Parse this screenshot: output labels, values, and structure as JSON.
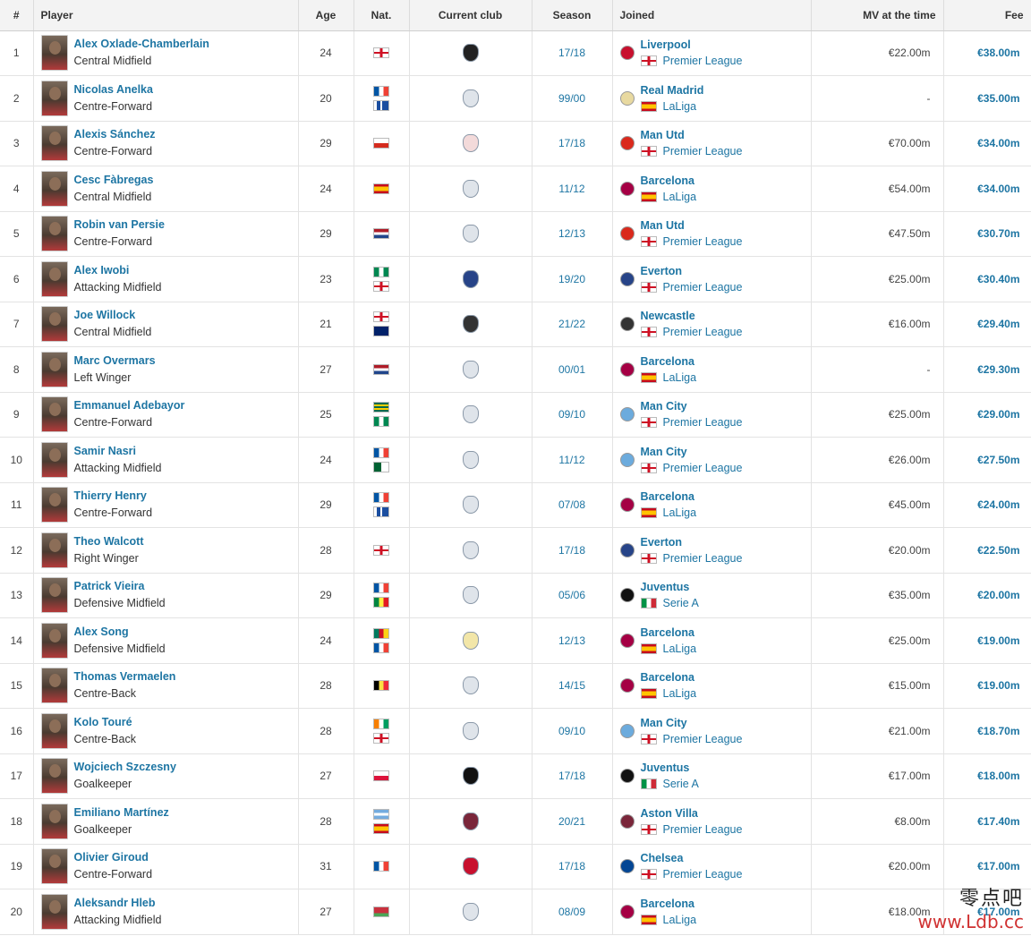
{
  "headers": {
    "num": "#",
    "player": "Player",
    "age": "Age",
    "nat": "Nat.",
    "club": "Current club",
    "season": "Season",
    "joined": "Joined",
    "mv": "MV at the time",
    "fee": "Fee"
  },
  "rows": [
    {
      "num": "1",
      "name": "Alex Oxlade-Chamberlain",
      "position": "Central Midfield",
      "age": "24",
      "nat": [
        "england"
      ],
      "club_icon": "besiktas-crest-icon",
      "season": "17/18",
      "joined_club": "Liverpool",
      "league": "Premier League",
      "league_flag": "england",
      "joined_icon": "liverpool-crest-icon",
      "mv": "€22.00m",
      "fee": "€38.00m"
    },
    {
      "num": "2",
      "name": "Nicolas Anelka",
      "position": "Centre-Forward",
      "age": "20",
      "nat": [
        "france",
        "guadeloupe"
      ],
      "club_icon": "retired-icon",
      "season": "99/00",
      "joined_club": "Real Madrid",
      "league": "LaLiga",
      "league_flag": "spain",
      "joined_icon": "real-madrid-crest-icon",
      "mv": "-",
      "fee": "€35.00m"
    },
    {
      "num": "3",
      "name": "Alexis Sánchez",
      "position": "Centre-Forward",
      "age": "29",
      "nat": [
        "chile"
      ],
      "club_icon": "without-club-icon",
      "season": "17/18",
      "joined_club": "Man Utd",
      "league": "Premier League",
      "league_flag": "england",
      "joined_icon": "man-utd-crest-icon",
      "mv": "€70.00m",
      "fee": "€34.00m"
    },
    {
      "num": "4",
      "name": "Cesc Fàbregas",
      "position": "Central Midfield",
      "age": "24",
      "nat": [
        "spain"
      ],
      "club_icon": "retired-icon",
      "season": "11/12",
      "joined_club": "Barcelona",
      "league": "LaLiga",
      "league_flag": "spain",
      "joined_icon": "barcelona-crest-icon",
      "mv": "€54.00m",
      "fee": "€34.00m"
    },
    {
      "num": "5",
      "name": "Robin van Persie",
      "position": "Centre-Forward",
      "age": "29",
      "nat": [
        "netherlands"
      ],
      "club_icon": "retired-icon",
      "season": "12/13",
      "joined_club": "Man Utd",
      "league": "Premier League",
      "league_flag": "england",
      "joined_icon": "man-utd-crest-icon",
      "mv": "€47.50m",
      "fee": "€30.70m"
    },
    {
      "num": "6",
      "name": "Alex Iwobi",
      "position": "Attacking Midfield",
      "age": "23",
      "nat": [
        "nigeria",
        "england"
      ],
      "club_icon": "everton-crest-icon",
      "season": "19/20",
      "joined_club": "Everton",
      "league": "Premier League",
      "league_flag": "england",
      "joined_icon": "everton-crest-icon",
      "mv": "€25.00m",
      "fee": "€30.40m"
    },
    {
      "num": "7",
      "name": "Joe Willock",
      "position": "Central Midfield",
      "age": "21",
      "nat": [
        "england",
        "montserrat"
      ],
      "club_icon": "newcastle-crest-icon",
      "season": "21/22",
      "joined_club": "Newcastle",
      "league": "Premier League",
      "league_flag": "england",
      "joined_icon": "newcastle-crest-icon",
      "mv": "€16.00m",
      "fee": "€29.40m"
    },
    {
      "num": "8",
      "name": "Marc Overmars",
      "position": "Left Winger",
      "age": "27",
      "nat": [
        "netherlands"
      ],
      "club_icon": "retired-icon",
      "season": "00/01",
      "joined_club": "Barcelona",
      "league": "LaLiga",
      "league_flag": "spain",
      "joined_icon": "barcelona-crest-icon",
      "mv": "-",
      "fee": "€29.30m"
    },
    {
      "num": "9",
      "name": "Emmanuel Adebayor",
      "position": "Centre-Forward",
      "age": "25",
      "nat": [
        "togo",
        "nigeria"
      ],
      "club_icon": "retired-icon",
      "season": "09/10",
      "joined_club": "Man City",
      "league": "Premier League",
      "league_flag": "england",
      "joined_icon": "man-city-crest-icon",
      "mv": "€25.00m",
      "fee": "€29.00m"
    },
    {
      "num": "10",
      "name": "Samir Nasri",
      "position": "Attacking Midfield",
      "age": "24",
      "nat": [
        "france",
        "algeria"
      ],
      "club_icon": "retired-icon",
      "season": "11/12",
      "joined_club": "Man City",
      "league": "Premier League",
      "league_flag": "england",
      "joined_icon": "man-city-crest-icon",
      "mv": "€26.00m",
      "fee": "€27.50m"
    },
    {
      "num": "11",
      "name": "Thierry Henry",
      "position": "Centre-Forward",
      "age": "29",
      "nat": [
        "france",
        "guadeloupe"
      ],
      "club_icon": "retired-icon",
      "season": "07/08",
      "joined_club": "Barcelona",
      "league": "LaLiga",
      "league_flag": "spain",
      "joined_icon": "barcelona-crest-icon",
      "mv": "€45.00m",
      "fee": "€24.00m"
    },
    {
      "num": "12",
      "name": "Theo Walcott",
      "position": "Right Winger",
      "age": "28",
      "nat": [
        "england"
      ],
      "club_icon": "retired-icon",
      "season": "17/18",
      "joined_club": "Everton",
      "league": "Premier League",
      "league_flag": "england",
      "joined_icon": "everton-crest-icon",
      "mv": "€20.00m",
      "fee": "€22.50m"
    },
    {
      "num": "13",
      "name": "Patrick Vieira",
      "position": "Defensive Midfield",
      "age": "29",
      "nat": [
        "france",
        "senegal"
      ],
      "club_icon": "retired-icon",
      "season": "05/06",
      "joined_club": "Juventus",
      "league": "Serie A",
      "league_flag": "italy",
      "joined_icon": "juventus-crest-icon",
      "mv": "€35.00m",
      "fee": "€20.00m"
    },
    {
      "num": "14",
      "name": "Alex Song",
      "position": "Defensive Midfield",
      "age": "24",
      "nat": [
        "cameroon",
        "france"
      ],
      "club_icon": "arta-solar-crest-icon",
      "season": "12/13",
      "joined_club": "Barcelona",
      "league": "LaLiga",
      "league_flag": "spain",
      "joined_icon": "barcelona-crest-icon",
      "mv": "€25.00m",
      "fee": "€19.00m"
    },
    {
      "num": "15",
      "name": "Thomas Vermaelen",
      "position": "Centre-Back",
      "age": "28",
      "nat": [
        "belgium"
      ],
      "club_icon": "retired-icon",
      "season": "14/15",
      "joined_club": "Barcelona",
      "league": "LaLiga",
      "league_flag": "spain",
      "joined_icon": "barcelona-crest-icon",
      "mv": "€15.00m",
      "fee": "€19.00m"
    },
    {
      "num": "16",
      "name": "Kolo Touré",
      "position": "Centre-Back",
      "age": "28",
      "nat": [
        "cote-divoire",
        "england"
      ],
      "club_icon": "retired-icon",
      "season": "09/10",
      "joined_club": "Man City",
      "league": "Premier League",
      "league_flag": "england",
      "joined_icon": "man-city-crest-icon",
      "mv": "€21.00m",
      "fee": "€18.70m"
    },
    {
      "num": "17",
      "name": "Wojciech Szczesny",
      "position": "Goalkeeper",
      "age": "27",
      "nat": [
        "poland"
      ],
      "club_icon": "juventus-crest-icon",
      "season": "17/18",
      "joined_club": "Juventus",
      "league": "Serie A",
      "league_flag": "italy",
      "joined_icon": "juventus-crest-icon",
      "mv": "€17.00m",
      "fee": "€18.00m"
    },
    {
      "num": "18",
      "name": "Emiliano Martínez",
      "position": "Goalkeeper",
      "age": "28",
      "nat": [
        "argentina",
        "spain"
      ],
      "club_icon": "aston-villa-crest-icon",
      "season": "20/21",
      "joined_club": "Aston Villa",
      "league": "Premier League",
      "league_flag": "england",
      "joined_icon": "aston-villa-crest-icon",
      "mv": "€8.00m",
      "fee": "€17.40m"
    },
    {
      "num": "19",
      "name": "Olivier Giroud",
      "position": "Centre-Forward",
      "age": "31",
      "nat": [
        "france"
      ],
      "club_icon": "ac-milan-crest-icon",
      "season": "17/18",
      "joined_club": "Chelsea",
      "league": "Premier League",
      "league_flag": "england",
      "joined_icon": "chelsea-crest-icon",
      "mv": "€20.00m",
      "fee": "€17.00m"
    },
    {
      "num": "20",
      "name": "Aleksandr Hleb",
      "position": "Attacking Midfield",
      "age": "27",
      "nat": [
        "belarus"
      ],
      "club_icon": "retired-icon",
      "season": "08/09",
      "joined_club": "Barcelona",
      "league": "LaLiga",
      "league_flag": "spain",
      "joined_icon": "barcelona-crest-icon",
      "mv": "€18.00m",
      "fee": "€17.00m"
    }
  ],
  "flag_styles": {
    "england": "linear-gradient(90deg,transparent 42%,#ce1124 42%,#ce1124 58%,transparent 58%),linear-gradient(0deg,#fff 38%,#ce1124 38%,#ce1124 62%,#fff 62%)",
    "france": "linear-gradient(90deg,#0055a4 33%,#fff 33%,#fff 66%,#ef4135 66%)",
    "spain": "linear-gradient(180deg,#c60b1e 25%,#ffc400 25%,#ffc400 75%,#c60b1e 75%)",
    "chile": "linear-gradient(180deg,#fff 50%,#d52b1e 50%)",
    "netherlands": "linear-gradient(180deg,#ae1c28 33%,#fff 33%,#fff 66%,#21468b 66%)",
    "nigeria": "linear-gradient(90deg,#008751 33%,#fff 33%,#fff 66%,#008751 66%)",
    "montserrat": "linear-gradient(135deg,#012169 0%,#012169 100%)",
    "togo": "linear-gradient(180deg,#006a4e 20%,#ffce00 20%,#ffce00 40%,#006a4e 40%,#006a4e 60%,#ffce00 60%,#ffce00 80%,#006a4e 80%)",
    "algeria": "linear-gradient(90deg,#006233 50%,#fff 50%)",
    "guadeloupe": "linear-gradient(90deg,#fff 20%,#1b4ea0 20%,#1b4ea0 45%,#fff 45%,#fff 55%,#1b4ea0 55%)",
    "senegal": "linear-gradient(90deg,#00853f 33%,#fdef42 33%,#fdef42 66%,#e31b23 66%)",
    "cameroon": "linear-gradient(90deg,#007a5e 33%,#ce1126 33%,#ce1126 66%,#fcd116 66%)",
    "belgium": "linear-gradient(90deg,#000 33%,#fae042 33%,#fae042 66%,#ed2939 66%)",
    "cote-divoire": "linear-gradient(90deg,#f77f00 33%,#fff 33%,#fff 66%,#009e60 66%)",
    "poland": "linear-gradient(180deg,#fff 50%,#dc143c 50%)",
    "argentina": "linear-gradient(180deg,#74acdf 33%,#fff 33%,#fff 66%,#74acdf 66%)",
    "belarus": "linear-gradient(180deg,#c8313e 66%,#4aa657 66%)",
    "italy": "linear-gradient(90deg,#009246 33%,#fff 33%,#fff 66%,#ce2b37 66%)"
  },
  "crest_colors": {
    "retired-icon": "#dfe4ea",
    "without-club-icon": "#f3dada",
    "besiktas-crest-icon": "#222222",
    "everton-crest-icon": "#274488",
    "newcastle-crest-icon": "#333333",
    "arta-solar-crest-icon": "#f2e6a8",
    "juventus-crest-icon": "#111111",
    "aston-villa-crest-icon": "#7a263a",
    "ac-milan-crest-icon": "#c8102e",
    "liverpool-crest-icon": "#c8102e",
    "real-madrid-crest-icon": "#e8d9a0",
    "man-utd-crest-icon": "#da291c",
    "barcelona-crest-icon": "#a50044",
    "man-city-crest-icon": "#6cabdd",
    "chelsea-crest-icon": "#034694"
  },
  "watermark": {
    "top": "零点吧",
    "bottom": "www.Ldb.cc"
  }
}
